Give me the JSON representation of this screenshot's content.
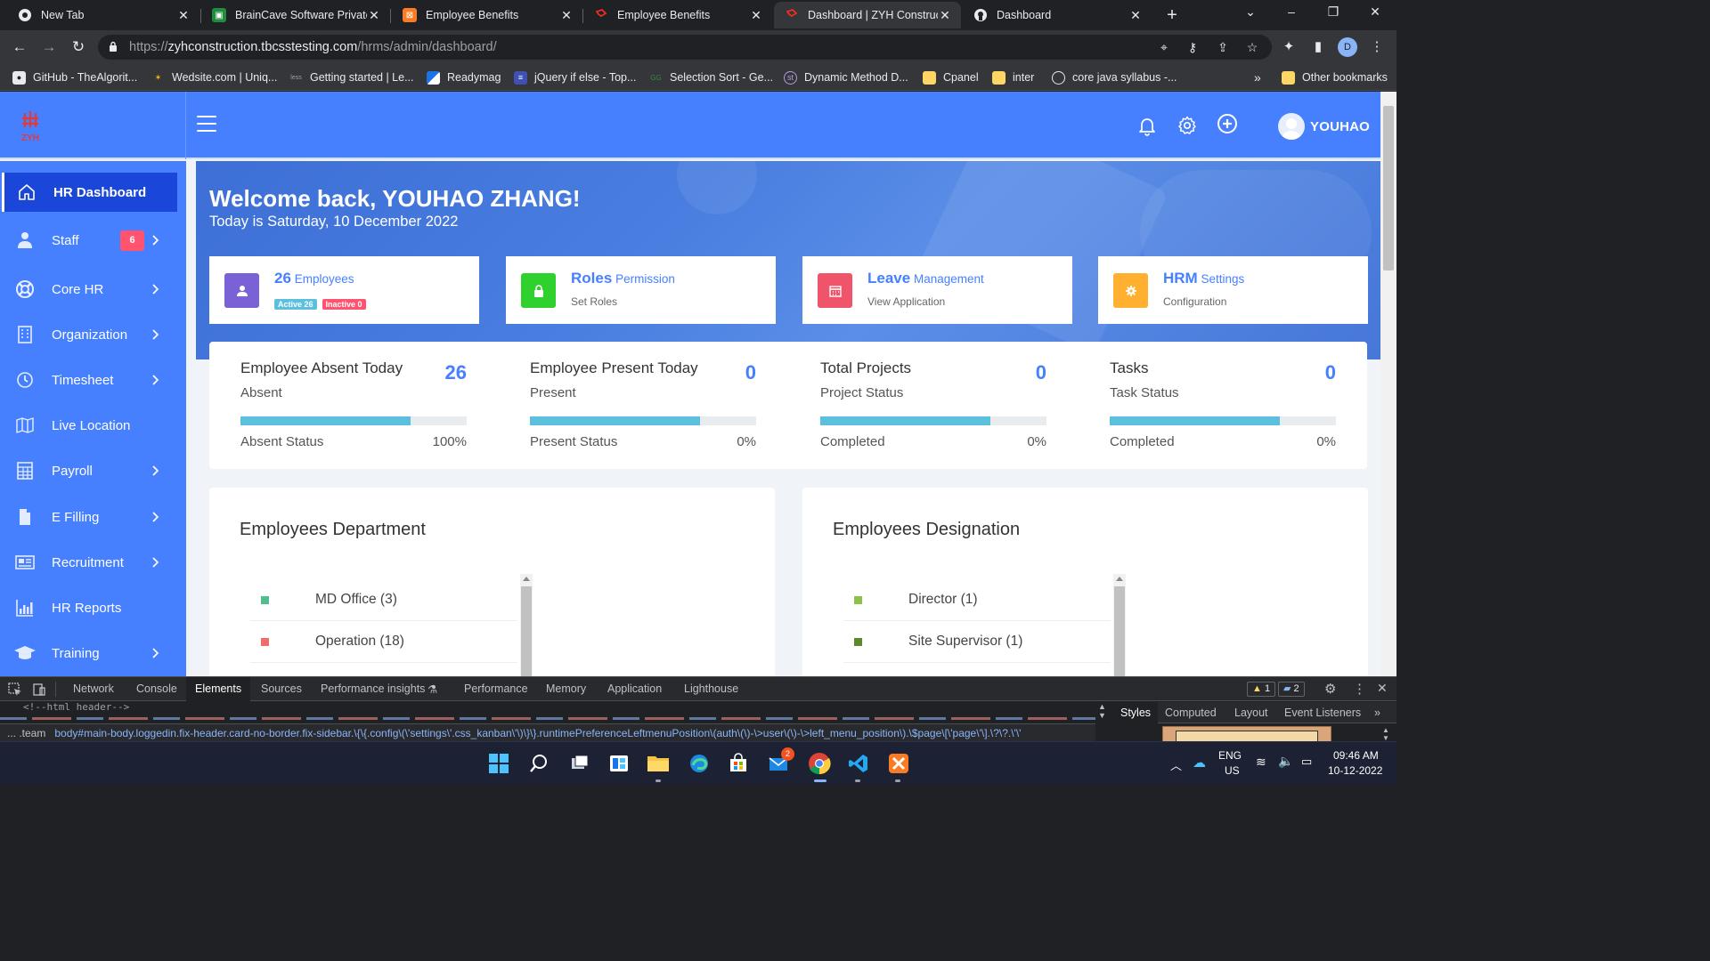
{
  "browser": {
    "tabs": [
      {
        "title": "New Tab",
        "icon": "chrome-icon",
        "active": false
      },
      {
        "title": "BrainCave Software Private",
        "icon": "braincave-icon",
        "active": false
      },
      {
        "title": "Employee Benefits",
        "icon": "xampp-icon",
        "active": false
      },
      {
        "title": "Employee Benefits",
        "icon": "laravel-icon",
        "active": false
      },
      {
        "title": "Dashboard | ZYH Construct",
        "icon": "laravel-icon",
        "active": true
      },
      {
        "title": "Dashboard",
        "icon": "github-icon",
        "active": false
      }
    ],
    "url_prefix": "https://",
    "url_domain": "zyhconstruction.tbcsstesting.com",
    "url_path": "/hrms/admin/dashboard/",
    "profile_initial": "D",
    "bookmarks": [
      "GitHub - TheAlgorit...",
      "Wedsite.com | Uniq...",
      "Getting started | Le...",
      "Readymag",
      "jQuery if else - Top...",
      "Selection Sort - Ge...",
      "Dynamic Method D...",
      "Cpanel",
      "inter",
      "core java syllabus -..."
    ],
    "more_bookmarks": "»",
    "other_bookmarks": "Other bookmarks"
  },
  "app": {
    "logo_text": "ZYH",
    "user_name": "YOUHAO",
    "welcome": "Welcome back, YOUHAO ZHANG!",
    "today": "Today is Saturday, 10 December 2022"
  },
  "sidebar": {
    "items": [
      {
        "label": "HR Dashboard",
        "icon": "home-icon",
        "active": true,
        "chevron": false
      },
      {
        "label": "Staff",
        "icon": "person-icon",
        "active": false,
        "chevron": true,
        "badge": "6"
      },
      {
        "label": "Core HR",
        "icon": "lifebuoy-icon",
        "active": false,
        "chevron": true
      },
      {
        "label": "Organization",
        "icon": "building-icon",
        "active": false,
        "chevron": true
      },
      {
        "label": "Timesheet",
        "icon": "clock-icon",
        "active": false,
        "chevron": true
      },
      {
        "label": "Live Location",
        "icon": "map-icon",
        "active": false,
        "chevron": false
      },
      {
        "label": "Payroll",
        "icon": "calculator-icon",
        "active": false,
        "chevron": true
      },
      {
        "label": "E Filling",
        "icon": "file-icon",
        "active": false,
        "chevron": true
      },
      {
        "label": "Recruitment",
        "icon": "newspaper-icon",
        "active": false,
        "chevron": true
      },
      {
        "label": "HR Reports",
        "icon": "bar-chart-icon",
        "active": false,
        "chevron": false
      },
      {
        "label": "Training",
        "icon": "graduation-cap-icon",
        "active": false,
        "chevron": true
      }
    ]
  },
  "quick_cards": [
    {
      "bold": "26",
      "text": "Employees",
      "color": "#7b61d6",
      "icon": "user-icon",
      "active_pill": "Active 26",
      "inactive_pill": "Inactive 0"
    },
    {
      "bold": "Roles",
      "text": "Permission",
      "sub": "Set Roles",
      "color": "#2ed12e",
      "icon": "lock-icon"
    },
    {
      "bold": "Leave",
      "text": "Management",
      "sub": "View Application",
      "color": "#f0546a",
      "icon": "calendar-icon"
    },
    {
      "bold": "HRM",
      "text": "Settings",
      "sub": "Configuration",
      "color": "#ffb030",
      "icon": "gear-icon"
    }
  ],
  "stats": [
    {
      "title": "Employee Absent Today",
      "sub": "Absent",
      "value": "26",
      "label": "Absent Status",
      "pct": "100%",
      "bar_fraction": 0.75
    },
    {
      "title": "Employee Present Today",
      "sub": "Present",
      "value": "0",
      "label": "Present Status",
      "pct": "0%",
      "bar_fraction": 0.75
    },
    {
      "title": "Total Projects",
      "sub": "Project Status",
      "value": "0",
      "label": "Completed",
      "pct": "0%",
      "bar_fraction": 0.75
    },
    {
      "title": "Tasks",
      "sub": "Task Status",
      "value": "0",
      "label": "Completed",
      "pct": "0%",
      "bar_fraction": 0.75
    }
  ],
  "departments": {
    "title": "Employees Department",
    "items": [
      {
        "label": "MD Office (3)",
        "color": "#4fc08d"
      },
      {
        "label": "Operation (18)",
        "color": "#f26a6a"
      }
    ]
  },
  "designations": {
    "title": "Employees Designation",
    "items": [
      {
        "label": "Director (1)",
        "color": "#8bc34a"
      },
      {
        "label": "Site Supervisor (1)",
        "color": "#5a8a2a"
      }
    ]
  },
  "devtools": {
    "tabs": [
      "Network",
      "Console",
      "Elements",
      "Sources",
      "Performance insights",
      "Performance",
      "Memory",
      "Application",
      "Lighthouse"
    ],
    "active_tab": "Elements",
    "warnings": "1",
    "messages": "2",
    "html_comment": "<!--html header-->",
    "crumb_prefix": "... .team",
    "crumb": "body#main-body.loggedin.fix-header.card-no-border.fix-sidebar.\\{\\{.config\\(\\'settings\\'.css_kanban\\'\\)\\}\\}.runtimePreferenceLeftmenuPosition\\(auth\\(\\)-\\>user\\(\\)-\\>left_menu_position\\).\\$page\\[\\'page\\'\\].\\?\\?.\\'\\'",
    "side_tabs": [
      "Styles",
      "Computed",
      "Layout",
      "Event Listeners"
    ],
    "more": "»"
  },
  "taskbar": {
    "lang": "ENG",
    "region": "US",
    "time": "09:46 AM",
    "date": "10-12-2022",
    "mail_badge": "2"
  }
}
